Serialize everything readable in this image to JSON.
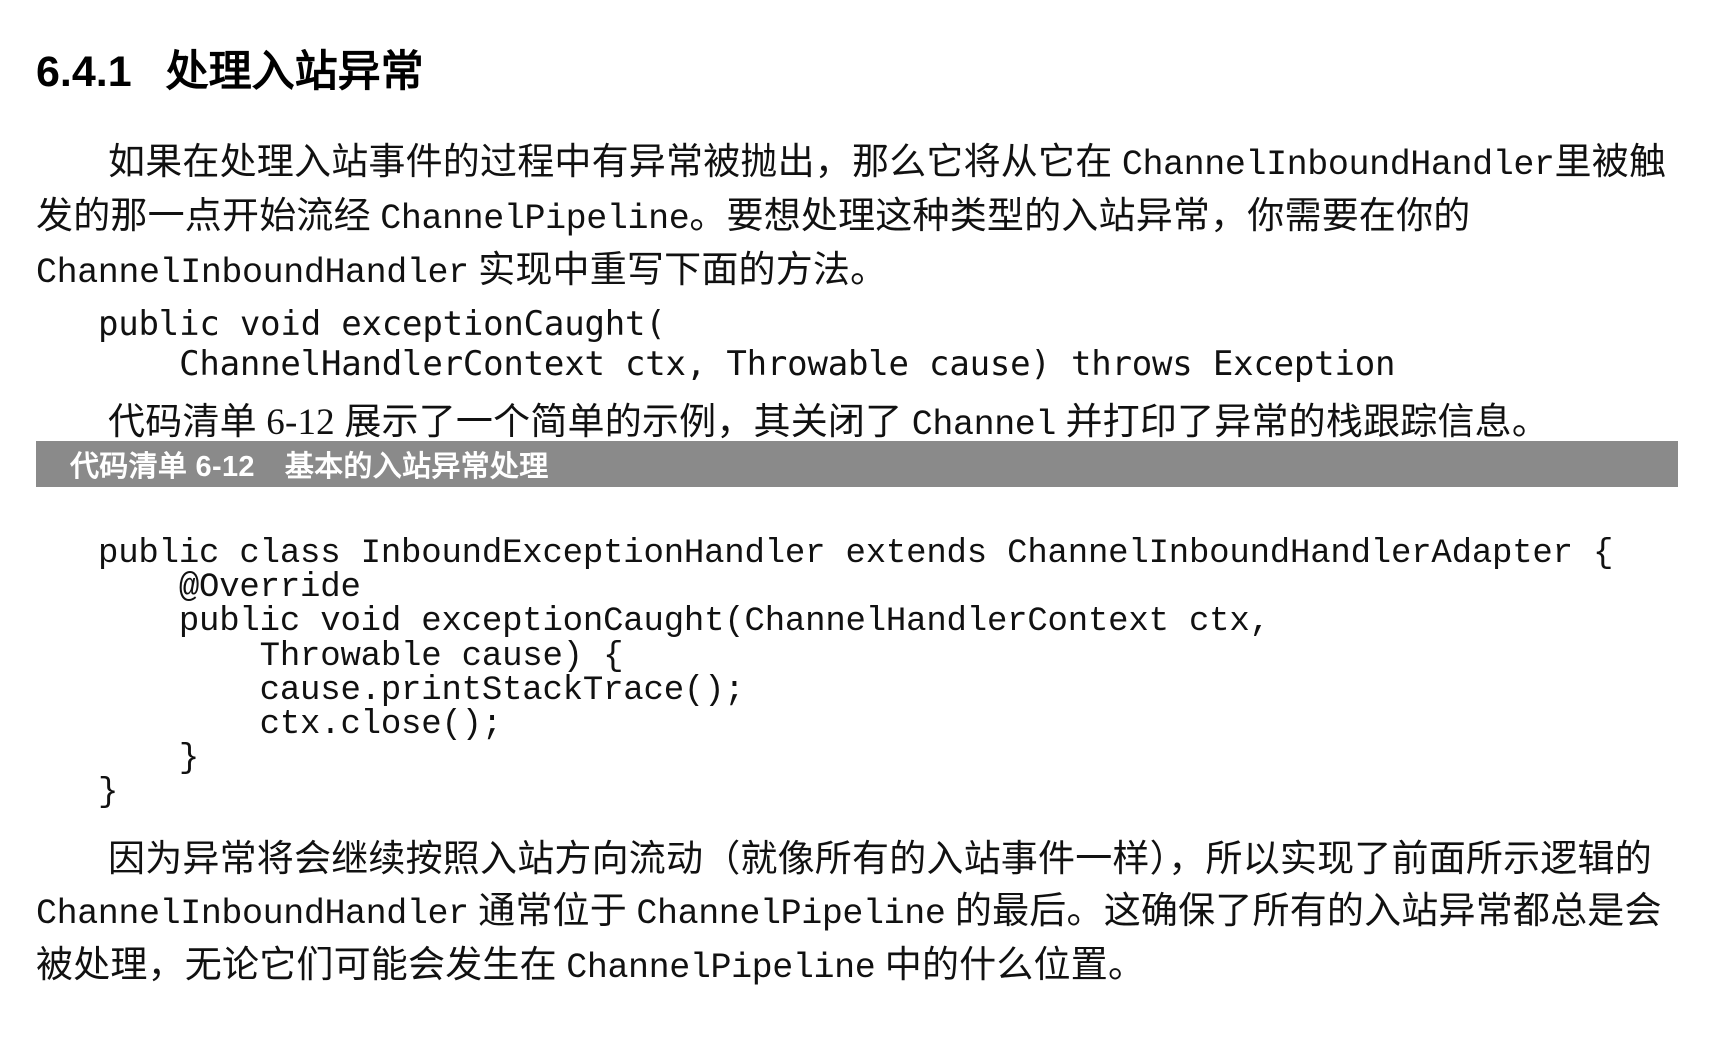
{
  "document": {
    "heading": {
      "number": "6.4.1",
      "title": "处理入站异常"
    },
    "paragraph_1": {
      "line_1": "如果在处理入站事件的过程中有异常被抛出，那么它将从它在 ",
      "code_1": "ChannelInboundHandler",
      "line_2": "里被触发的那一点开始流经 ",
      "code_2": "ChannelPipeline",
      "line_3": "。要想处理这种类型的入站异常，你需要在你的 ",
      "code_3": "ChannelInboundHandler",
      "line_4": " 实现中重写下面的方法。"
    },
    "inline_code": {
      "lines": [
        "public void exceptionCaught(",
        "    ChannelHandlerContext ctx, Throwable cause) throws Exception"
      ]
    },
    "paragraph_2": {
      "text_1": "代码清单 6-12 展示了一个简单的示例，其关闭了 ",
      "code_1": "Channel",
      "text_2": " 并打印了异常的栈跟踪信息。"
    },
    "listing_caption": {
      "label": "代码清单 6-12",
      "title": "基本的入站异常处理",
      "bar_color": "#8a8a8a",
      "text_color": "#ffffff"
    },
    "listing_code": {
      "lines": [
        "public class InboundExceptionHandler extends ChannelInboundHandlerAdapter {",
        "    @Override",
        "    public void exceptionCaught(ChannelHandlerContext ctx,",
        "        Throwable cause) {",
        "        cause.printStackTrace();",
        "        ctx.close();",
        "    }",
        "}"
      ]
    },
    "paragraph_3": {
      "text_1": "因为异常将会继续按照入站方向流动（就像所有的入站事件一样），所以实现了前面所示逻辑的 ",
      "code_1": "ChannelInboundHandler",
      "text_2": " 通常位于 ",
      "code_2": "ChannelPipeline",
      "text_3": " 的最后。这确保了所有的入站异常都总是会被处理，无论它们可能会发生在 ",
      "code_3": "ChannelPipeline",
      "text_4": " 中的什么位置。"
    }
  }
}
